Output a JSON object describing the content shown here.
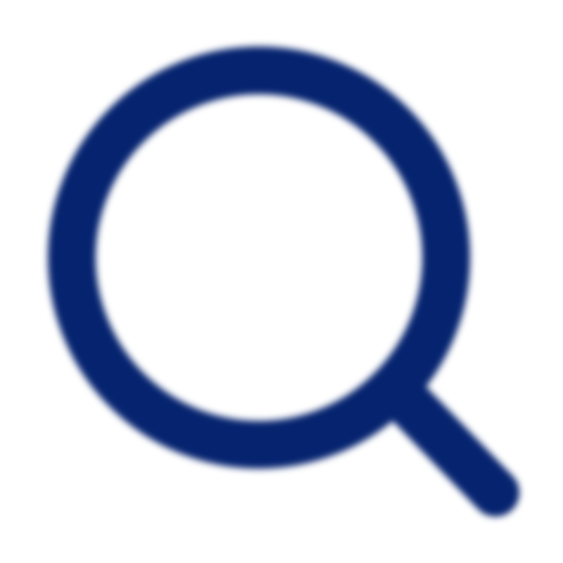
{
  "icon": {
    "name": "search-icon",
    "color": "#05236f",
    "background": "#ffffff"
  }
}
